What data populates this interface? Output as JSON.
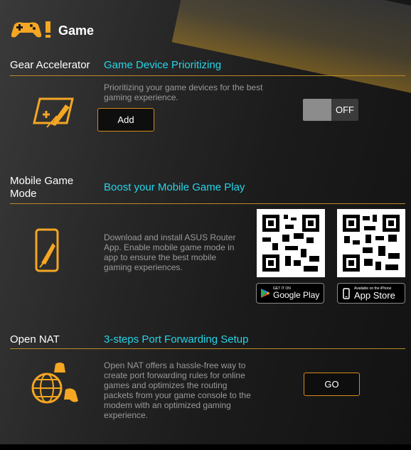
{
  "header": {
    "title": "Game",
    "icon": "gamepad-icon"
  },
  "colors": {
    "accent": "#26d5e8",
    "divider": "#b88a2a",
    "button_border": "#d48a1c",
    "icon": "#f5a623"
  },
  "gear": {
    "label": "Gear Accelerator",
    "title": "Game Device Prioritizing",
    "description": "Prioritizing your game devices for the best gaming experience.",
    "add_label": "Add",
    "toggle_state": "OFF"
  },
  "mobile": {
    "label": "Mobile Game Mode",
    "title": "Boost your Mobile Game Play",
    "description": "Download and install ASUS Router App. Enable mobile game mode in app to ensure the best mobile gaming experiences.",
    "google_small": "GET IT ON",
    "google_big": "Google Play",
    "apple_small": "Available on the iPhone",
    "apple_big": "App Store"
  },
  "nat": {
    "label": "Open NAT",
    "title": "3-steps Port Forwarding Setup",
    "description": "Open NAT offers a hassle-free way to create port forwarding rules for online games and optimizes the routing packets from your game console to the modem with an optimized gaming experience.",
    "go_label": "GO"
  }
}
